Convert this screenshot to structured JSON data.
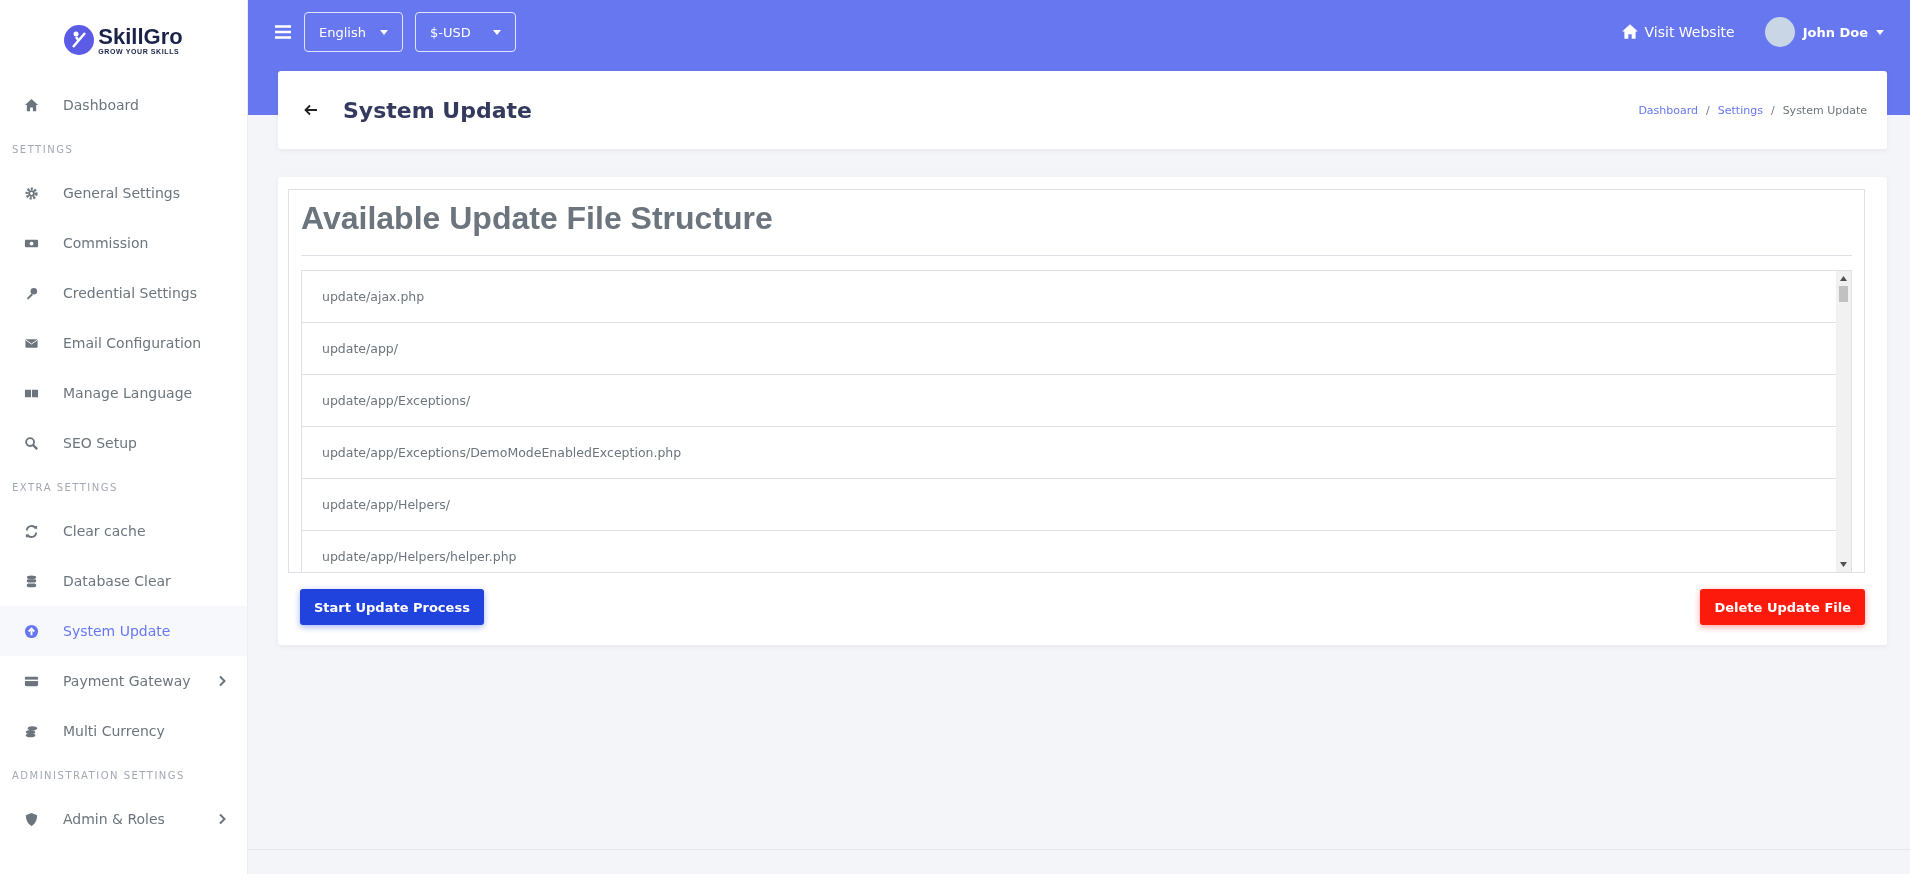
{
  "logo": {
    "name": "SkillGro",
    "tagline": "GROW YOUR SKILLS"
  },
  "sidebar": {
    "items": [
      {
        "kind": "item",
        "label": "Dashboard",
        "selected": false,
        "has_submenu": false
      },
      {
        "kind": "section",
        "label": "SETTINGS"
      },
      {
        "kind": "item",
        "label": "General Settings",
        "selected": false,
        "has_submenu": false
      },
      {
        "kind": "item",
        "label": "Commission",
        "selected": false,
        "has_submenu": false
      },
      {
        "kind": "item",
        "label": "Credential Settings",
        "selected": false,
        "has_submenu": false
      },
      {
        "kind": "item",
        "label": "Email Configuration",
        "selected": false,
        "has_submenu": false
      },
      {
        "kind": "item",
        "label": "Manage Language",
        "selected": false,
        "has_submenu": false
      },
      {
        "kind": "item",
        "label": "SEO Setup",
        "selected": false,
        "has_submenu": false
      },
      {
        "kind": "section",
        "label": "EXTRA SETTINGS"
      },
      {
        "kind": "item",
        "label": "Clear cache",
        "selected": false,
        "has_submenu": false
      },
      {
        "kind": "item",
        "label": "Database Clear",
        "selected": false,
        "has_submenu": false
      },
      {
        "kind": "item",
        "label": "System Update",
        "selected": true,
        "has_submenu": false
      },
      {
        "kind": "item",
        "label": "Payment Gateway",
        "selected": false,
        "has_submenu": true
      },
      {
        "kind": "item",
        "label": "Multi Currency",
        "selected": false,
        "has_submenu": false
      },
      {
        "kind": "section",
        "label": "ADMINISTRATION SETTINGS"
      },
      {
        "kind": "item",
        "label": "Admin & Roles",
        "selected": false,
        "has_submenu": true
      }
    ]
  },
  "topbar": {
    "language": "English",
    "currency": "$-USD",
    "visit_website": "Visit Website",
    "user": "John Doe"
  },
  "header": {
    "title": "System Update",
    "breadcrumb": [
      {
        "kind": "link",
        "label": "Dashboard"
      },
      {
        "kind": "separator",
        "label": "/"
      },
      {
        "kind": "link",
        "label": "Settings"
      },
      {
        "kind": "separator",
        "label": "/"
      },
      {
        "kind": "current",
        "label": "System Update"
      }
    ]
  },
  "card": {
    "title": "Available Update File Structure",
    "files": [
      "update/ajax.php",
      "update/app/",
      "update/app/Exceptions/",
      "update/app/Exceptions/DemoModeEnabledException.php",
      "update/app/Helpers/",
      "update/app/Helpers/helper.php"
    ],
    "start_button": "Start Update Process",
    "delete_button": "Delete Update File"
  }
}
